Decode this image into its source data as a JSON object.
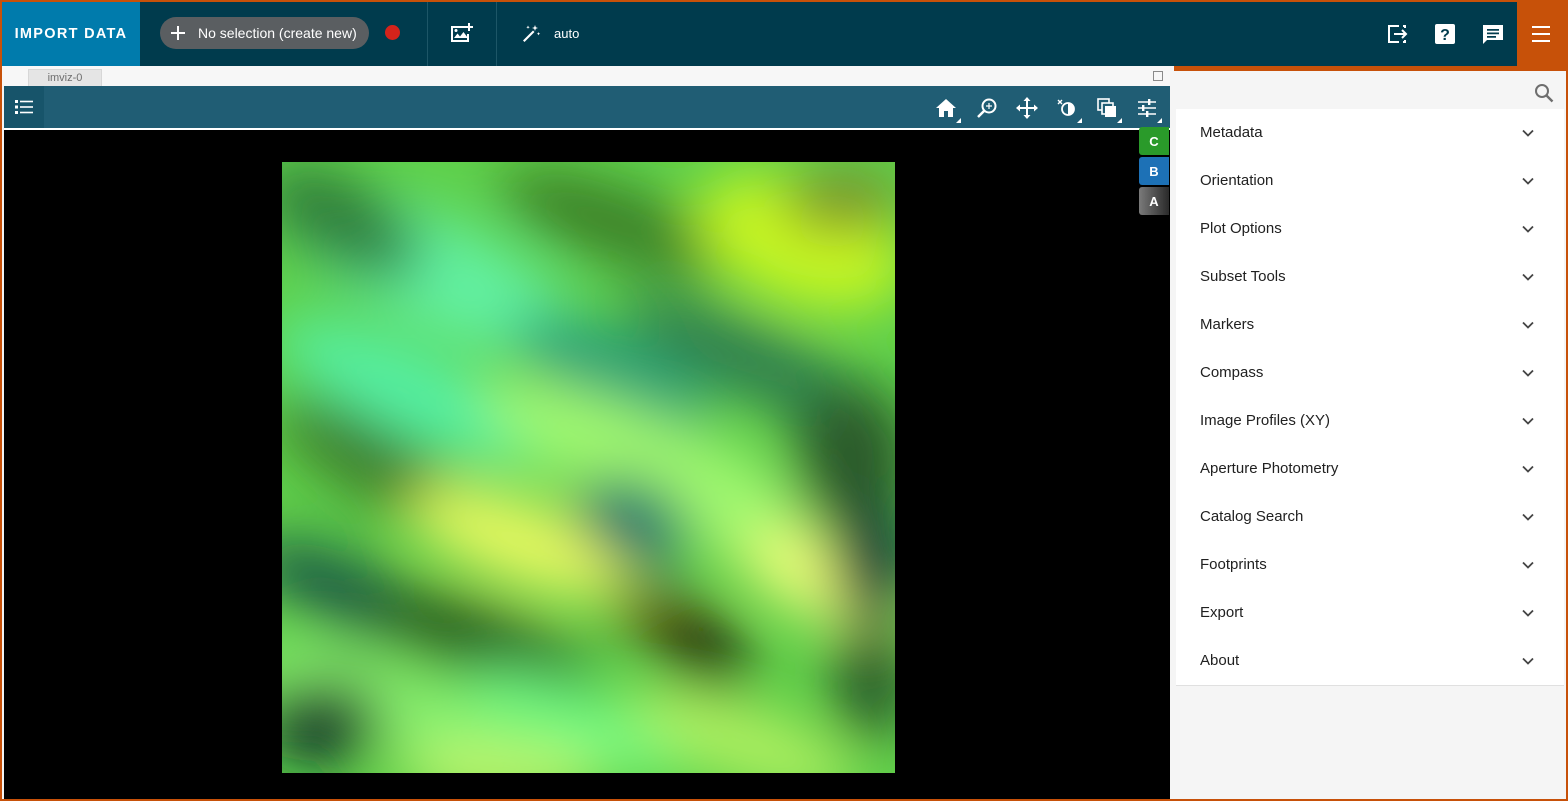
{
  "toolbar": {
    "import_label": "IMPORT DATA",
    "selection_label": "No selection (create new)",
    "link_mode": "auto",
    "record_color": "#d4231b",
    "icons": [
      "plus-icon",
      "add-image-icon",
      "wand-icon",
      "export-icon",
      "help-icon",
      "comment-icon",
      "hamburger-menu-icon"
    ]
  },
  "viewer": {
    "tab_label": "imviz-0",
    "tools": [
      "home-icon",
      "zoom-icon",
      "pan-icon",
      "contrast-bias-icon",
      "blink-icon",
      "settings-sliders-icon"
    ],
    "layers": [
      {
        "label": "C",
        "color": "#2a9a2a"
      },
      {
        "label": "B",
        "color": "#1d71b6"
      },
      {
        "label": "A",
        "color": "#555555"
      }
    ]
  },
  "tray": {
    "search_placeholder": "",
    "plugins": [
      {
        "label": "Metadata"
      },
      {
        "label": "Orientation"
      },
      {
        "label": "Plot Options"
      },
      {
        "label": "Subset Tools"
      },
      {
        "label": "Markers"
      },
      {
        "label": "Compass"
      },
      {
        "label": "Image Profiles (XY)"
      },
      {
        "label": "Aperture Photometry"
      },
      {
        "label": "Catalog Search"
      },
      {
        "label": "Footprints"
      },
      {
        "label": "Export"
      },
      {
        "label": "About"
      }
    ]
  },
  "colors": {
    "accent": "#c75109",
    "topbar": "#003b4d",
    "import": "#007bac",
    "viewer_toolbar": "#205d74"
  }
}
